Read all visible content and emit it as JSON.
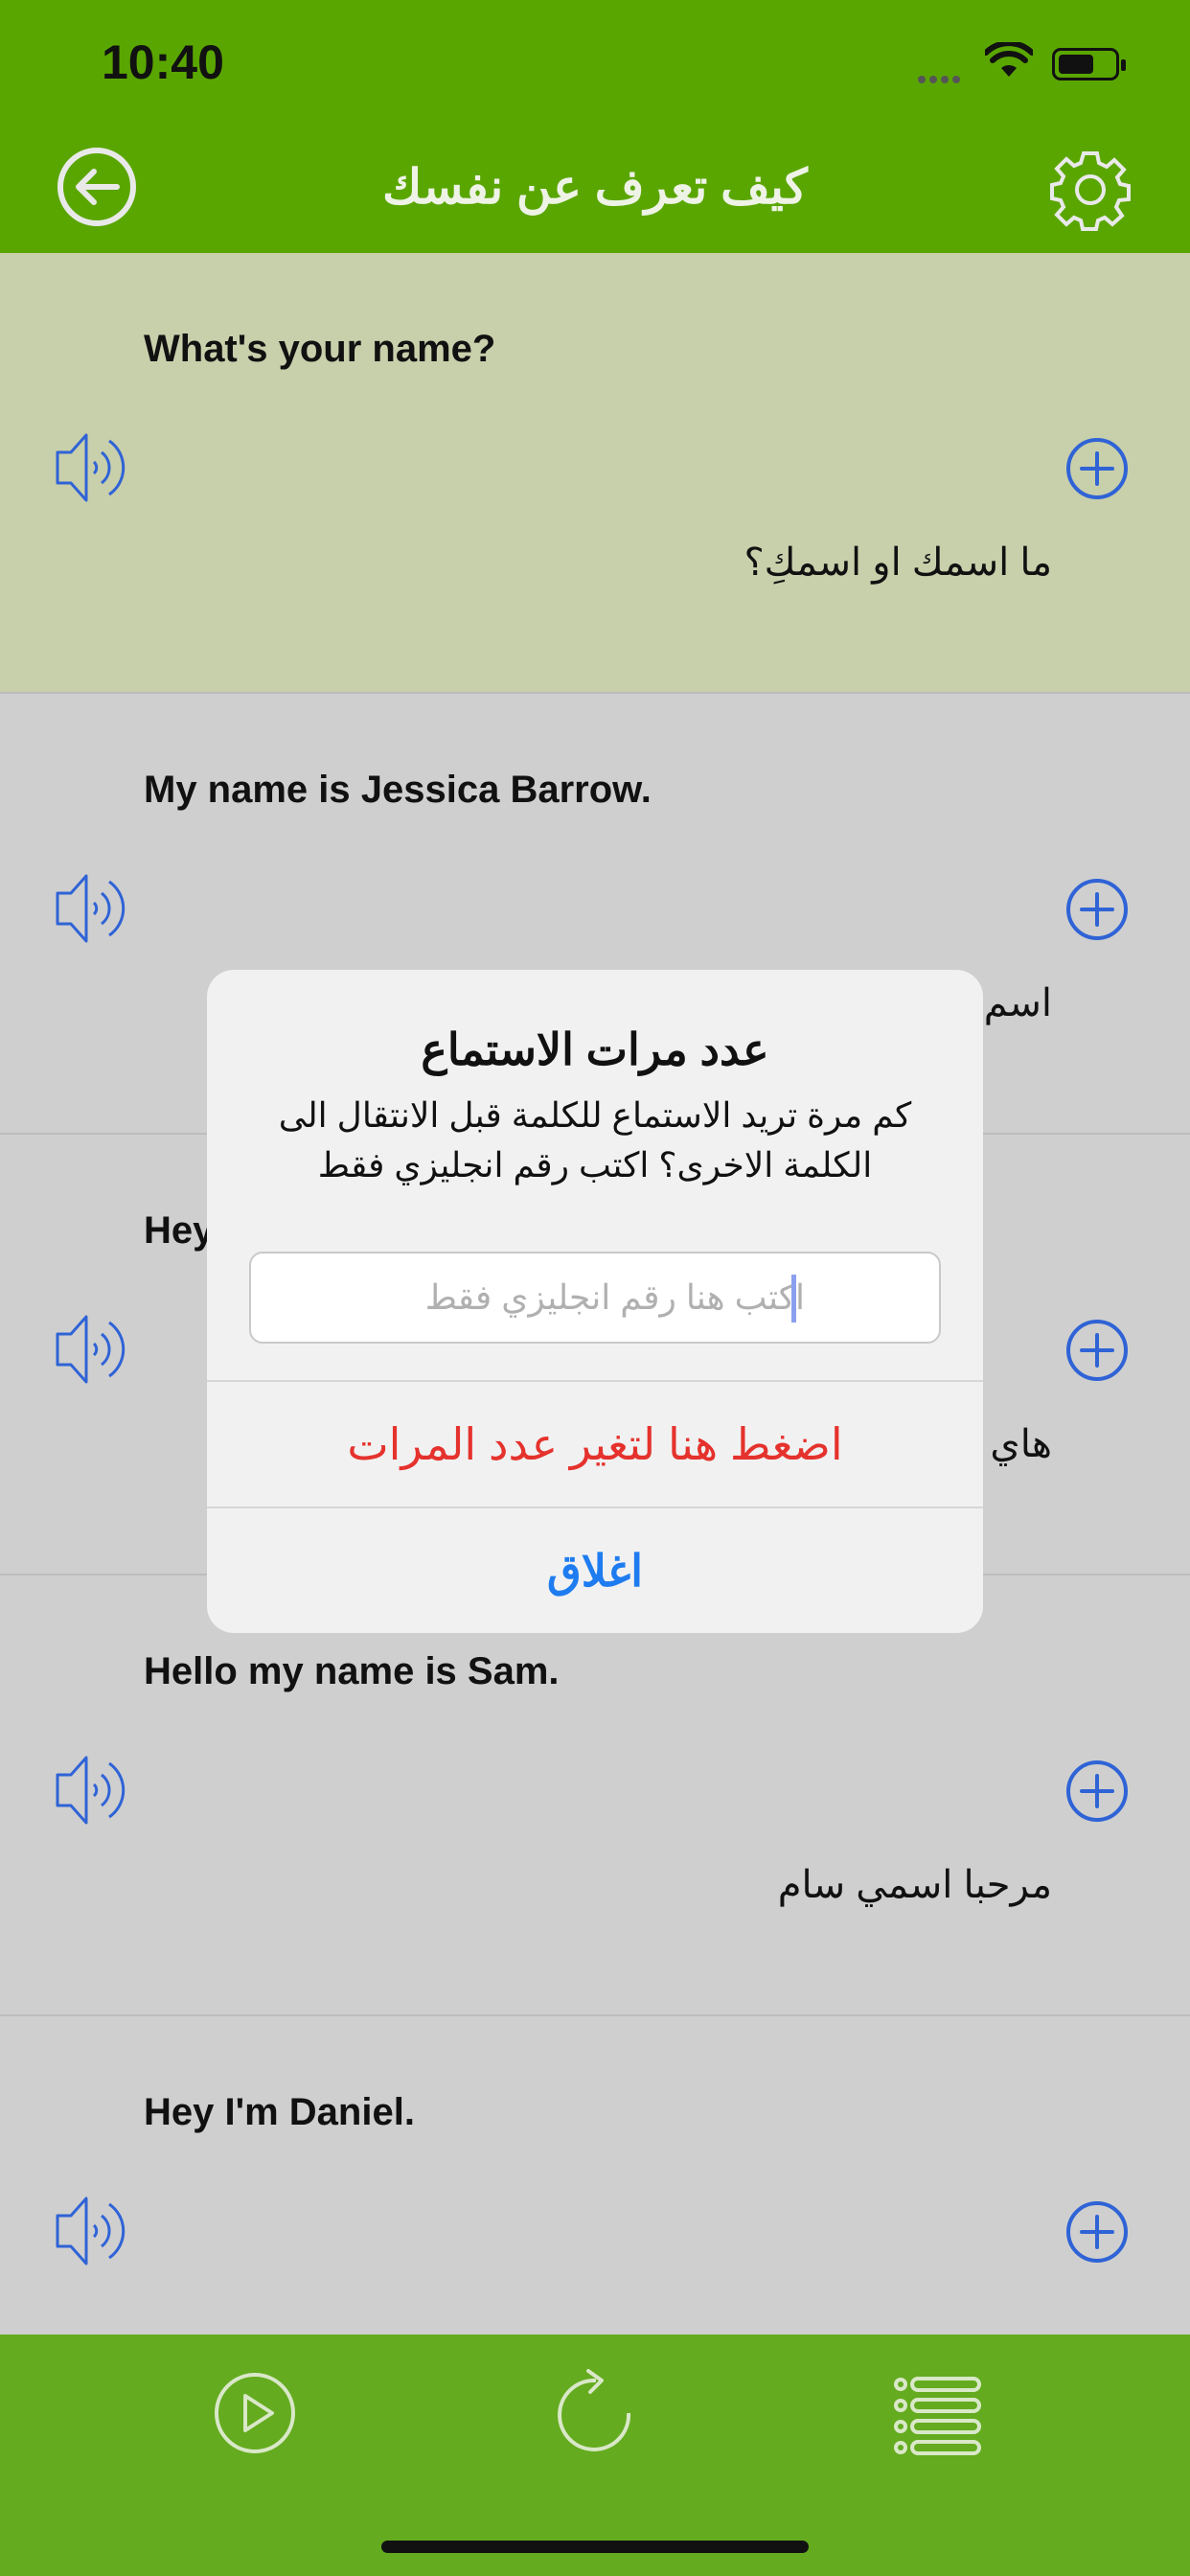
{
  "status_bar": {
    "time": "10:40"
  },
  "nav": {
    "title": "كيف تعرف عن نفسك"
  },
  "rows": [
    {
      "en": "What's your name?",
      "ar": "ما اسمك او اسمكِ؟",
      "active": true
    },
    {
      "en": "My name is Jessica Barrow.",
      "ar": "اسم"
    },
    {
      "en": "Hey",
      "ar": "هاي"
    },
    {
      "en": "Hello my name is Sam.",
      "ar": "مرحبا اسمي سام"
    },
    {
      "en": "Hey I'm Daniel.",
      "ar": ""
    }
  ],
  "dialog": {
    "title": "عدد مرات الاستماع",
    "message": "كم مرة تريد الاستماع للكلمة قبل الانتقال الى الكلمة الاخرى؟ اكتب رقم انجليزي فقط",
    "input_placeholder": "اكتب هنا رقم انجليزي فقط",
    "confirm_label": "اضغط هنا لتغير عدد المرات",
    "close_label": "اغلاق"
  },
  "colors": {
    "header_green": "#5aa600",
    "tab_green": "#64ab1f",
    "active_row": "#c8cfab",
    "row_bg": "#cfcfcf",
    "icon_blue": "#2f63d6",
    "destructive_red": "#e5322d",
    "action_blue": "#1e7cf0"
  },
  "icons": {
    "back": "arrow-left-circle-icon",
    "settings": "gear-icon",
    "speaker": "speaker-icon",
    "add": "plus-circle-icon",
    "play": "play-circle-icon",
    "repeat": "repeat-icon",
    "list": "list-icon"
  }
}
